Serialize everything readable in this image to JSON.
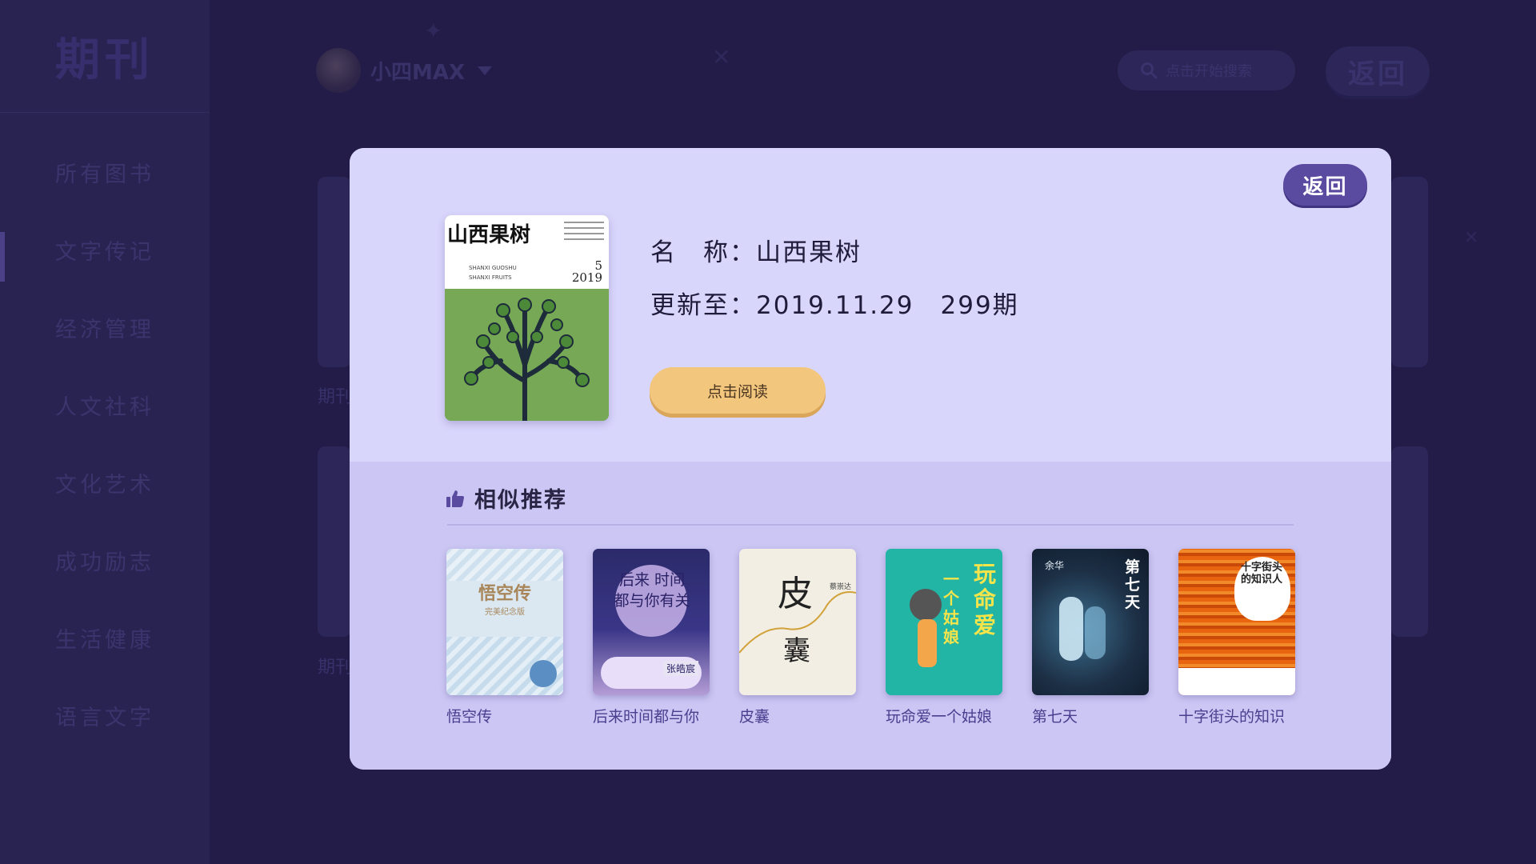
{
  "sidebar": {
    "title": "期刊",
    "items": [
      {
        "label": "所有图书"
      },
      {
        "label": "文字传记"
      },
      {
        "label": "经济管理"
      },
      {
        "label": "人文社科"
      },
      {
        "label": "文化艺术"
      },
      {
        "label": "成功励志"
      },
      {
        "label": "生活健康"
      },
      {
        "label": "语言文字"
      }
    ],
    "active_index": 1
  },
  "header": {
    "username": "小四MAX",
    "search_placeholder": "点击开始搜索",
    "back_label": "返回"
  },
  "background": {
    "card_label_1": "期刊",
    "card_label_2": "期刊"
  },
  "modal": {
    "back_label": "返回",
    "cover": {
      "title": "山西果树",
      "issue_number": "5",
      "issue_year": "2019",
      "subtitle_1": "SHANXI     GUOSHU",
      "subtitle_2": "SHANXI     FRUITS"
    },
    "name_line": "名　称：山西果树",
    "update_line": "更新至：2019.11.29　299期",
    "read_button": "点击阅读",
    "recommend": {
      "title": "相似推荐",
      "books": [
        {
          "title": "悟空传",
          "cover_text": "悟空传",
          "cover_sub": "完美纪念版"
        },
        {
          "title": "后来时间都与你",
          "cover_text": "后来 时间 都与你有关",
          "cover_sub": "张皓宸"
        },
        {
          "title": "皮囊",
          "cover_text": "皮",
          "cover_sub": "囊",
          "cover_author": "蔡崇达"
        },
        {
          "title": "玩命爱一个姑娘",
          "cover_text": "玩命爱",
          "cover_sub": "一个姑娘"
        },
        {
          "title": "第七天",
          "cover_text": "第七天",
          "cover_author": "余华"
        },
        {
          "title": "十字街头的知识",
          "cover_text": "十字街头的知识人"
        }
      ]
    }
  },
  "colors": {
    "modal_bg": "#d7d4fb",
    "modal_back_bg": "#5a4aa0",
    "read_button_bg": "#f3c67e",
    "page_bg": "#2b2356"
  }
}
